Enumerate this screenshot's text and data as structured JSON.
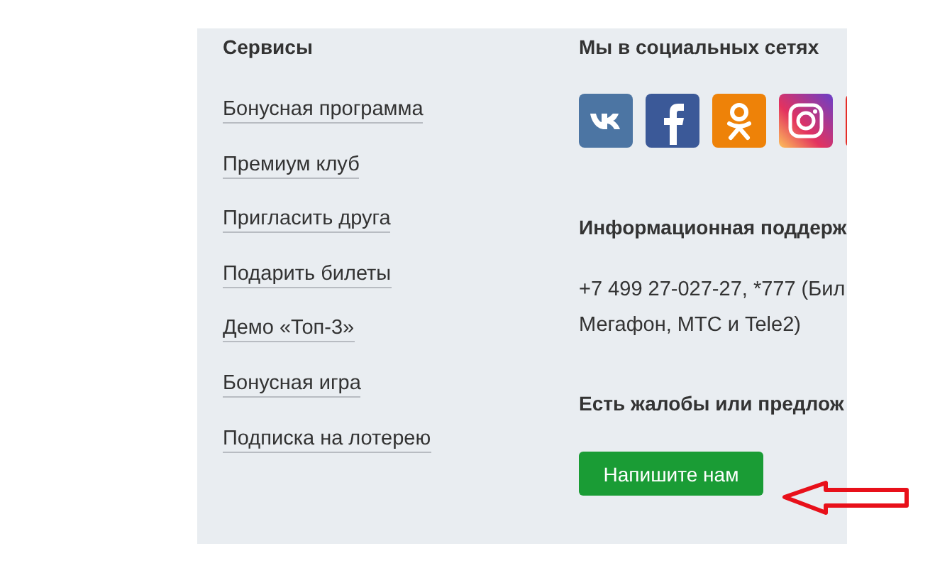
{
  "services": {
    "title": "Сервисы",
    "links": [
      {
        "label": "Бонусная программа"
      },
      {
        "label": "Премиум клуб"
      },
      {
        "label": "Пригласить друга"
      },
      {
        "label": "Подарить билеты"
      },
      {
        "label": "Демо «Топ-3»"
      },
      {
        "label": "Бонусная игра"
      },
      {
        "label": "Подписка на лотерею"
      }
    ]
  },
  "social": {
    "title": "Мы в социальных сетях",
    "icons": [
      {
        "kind": "vk"
      },
      {
        "kind": "facebook"
      },
      {
        "kind": "ok"
      },
      {
        "kind": "instagram"
      },
      {
        "kind": "red"
      }
    ]
  },
  "support": {
    "title": "Информационная поддерж",
    "lines": [
      "+7 499 27-027-27, *777 (Бил",
      "Мегафон, МТС и Tele2)"
    ]
  },
  "feedback": {
    "title": "Есть жалобы или предлож",
    "button": "Напишите нам"
  }
}
